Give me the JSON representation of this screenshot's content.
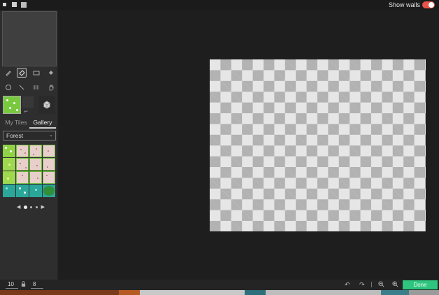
{
  "header": {
    "show_walls_label": "Show walls",
    "show_walls_on": true
  },
  "tools": {
    "row1": [
      "pencil-icon",
      "eraser-icon",
      "rectangle-icon",
      "fill-bucket-icon"
    ],
    "row2": [
      "circle-icon",
      "line-icon",
      "pattern-icon",
      "hand-icon"
    ],
    "active": "eraser-icon"
  },
  "tabs": [
    {
      "label": "My Tiles",
      "active": false
    },
    {
      "label": "Gallery",
      "active": true
    }
  ],
  "tileset": {
    "selected": "Forest"
  },
  "pager": {
    "prev_icon": "◀",
    "next_icon": "▶"
  },
  "bottom": {
    "width_value": "10",
    "height_value": "8",
    "done_label": "Done"
  },
  "colors": {
    "accent_green": "#2fc57f",
    "toggle_on": "#e8534a",
    "grass": "#8fd245",
    "teal": "#2aa79a",
    "path_pink": "#e9cfcb"
  }
}
